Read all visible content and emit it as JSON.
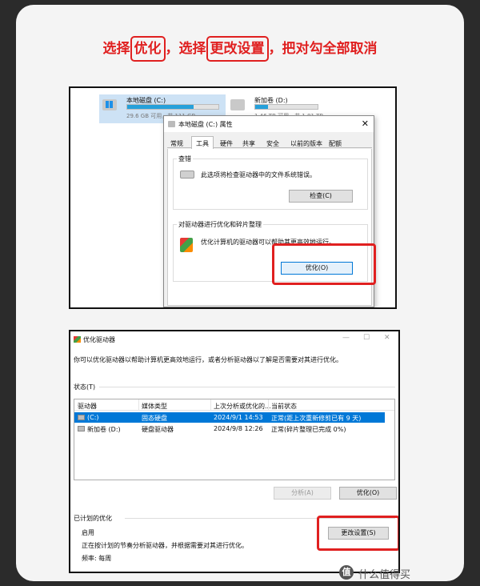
{
  "headline": {
    "part1": "选择",
    "part2": "优化",
    "part3": "，选择",
    "part4": "更改设置",
    "part5": "，把对勾全部取消"
  },
  "explorer": {
    "drive_c": {
      "name": "本地磁盘 (C:)",
      "size_text": "29.6 GB 可用，共 111 GB",
      "used_fraction": 0.73
    },
    "drive_d": {
      "name": "新加卷 (D:)",
      "size_text": "1.46 TB 可用，共 1.81 TB",
      "used_fraction": 0.2
    }
  },
  "properties_dialog": {
    "title": "本地磁盘 (C:) 属性",
    "close": "✕",
    "tabs": [
      "常规",
      "工具",
      "硬件",
      "共享",
      "安全",
      "以前的版本",
      "配额"
    ],
    "active_tab": "工具",
    "error_check": {
      "title": "查错",
      "desc": "此选项将检查驱动器中的文件系统错误。",
      "button": "检查(C)"
    },
    "optimize": {
      "title": "对驱动器进行优化和碎片整理",
      "desc": "优化计算机的驱动器可以帮助其更高效地运行。",
      "button": "优化(O)"
    }
  },
  "optimize_window": {
    "title": "优化驱动器",
    "controls": {
      "minimize": "—",
      "maximize": "☐",
      "close": "✕"
    },
    "intro": "你可以优化驱动器以帮助计算机更高效地运行，或者分析驱动器以了解是否需要对其进行优化。",
    "status_label": "状态(T)",
    "columns": [
      "驱动器",
      "媒体类型",
      "上次分析或优化的...",
      "当前状态"
    ],
    "rows": [
      {
        "drive": "(C:)",
        "media": "固态硬盘",
        "last": "2024/9/1 14:53",
        "status": "正常(距上次重新修剪已有 9 天)"
      },
      {
        "drive": "新加卷 (D:)",
        "media": "硬盘驱动器",
        "last": "2024/9/8 12:26",
        "status": "正常(碎片整理已完成 0%)"
      }
    ],
    "analyze_button": "分析(A)",
    "optimize_button": "优化(O)",
    "scheduled_label": "已计划的优化",
    "enabled": "启用",
    "scheduled_desc": "正在按计划的节奏分析驱动器，并根据需要对其进行优化。",
    "frequency": "频率: 每周",
    "change_settings_button": "更改设置(S)"
  },
  "watermark": {
    "badge": "值",
    "text": "什么值得买"
  },
  "colors": {
    "highlight": "#e02020",
    "selection": "#0078d7",
    "usage_bar": "#26a0da"
  }
}
